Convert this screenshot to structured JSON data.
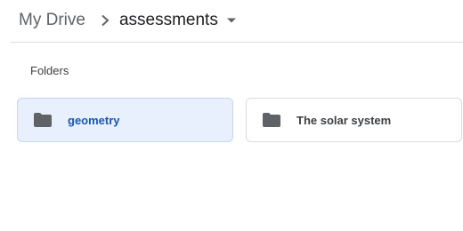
{
  "breadcrumb": {
    "root_label": "My Drive",
    "current_label": "assessments",
    "separator_icon": "chevron-right-icon",
    "menu_icon": "caret-down-icon"
  },
  "section": {
    "title": "Folders"
  },
  "folders": [
    {
      "name": "geometry",
      "selected": true,
      "icon": "folder-icon"
    },
    {
      "name": "The solar system",
      "selected": false,
      "icon": "folder-icon"
    }
  ],
  "colors": {
    "selected_bg": "#e8f0fe",
    "selected_text": "#1a56b8",
    "icon": "#5f6368",
    "divider": "#dadce0"
  }
}
